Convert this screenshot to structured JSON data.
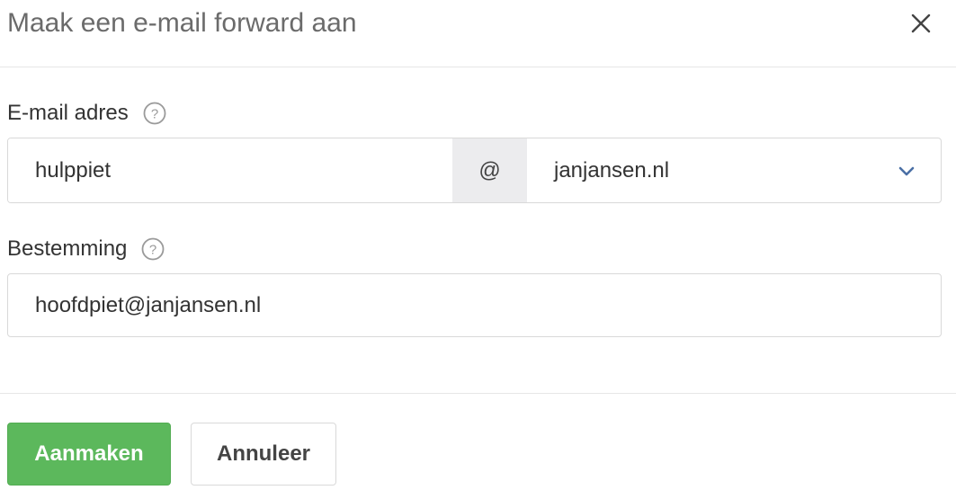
{
  "dialog": {
    "title": "Maak een e-mail forward aan"
  },
  "email_field": {
    "label": "E-mail adres",
    "local_part_value": "hulppiet",
    "at_symbol": "@",
    "domain_selected": "janjansen.nl"
  },
  "destination_field": {
    "label": "Bestemming",
    "value": "hoofdpiet@janjansen.nl"
  },
  "buttons": {
    "create_label": "Aanmaken",
    "cancel_label": "Annuleer"
  },
  "colors": {
    "primary_button": "#5cb85c",
    "chevron": "#4a6fa5",
    "addon_background": "#ececee"
  },
  "icons": {
    "close": "close-icon",
    "help": "help-icon",
    "dropdown": "chevron-down-icon"
  }
}
